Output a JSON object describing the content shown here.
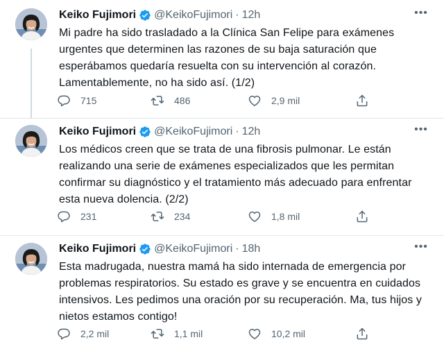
{
  "tweets": [
    {
      "name": "Keiko Fujimori",
      "handle": "@KeikoFujimori",
      "separator": "·",
      "time": "12h",
      "text": "Mi padre ha sido trasladado a la Clínica San Felipe para exámenes urgentes que determinen las razones de su baja saturación que esperábamos quedaría resuelta con su intervención al corazón. Lamentablemente, no ha sido así. (1/2)",
      "replies": "715",
      "retweets": "486",
      "likes": "2,9 mil"
    },
    {
      "name": "Keiko Fujimori",
      "handle": "@KeikoFujimori",
      "separator": "·",
      "time": "12h",
      "text": "Los médicos creen que se trata de una fibrosis pulmonar. Le están realizando una serie de exámenes especializados que les permitan confirmar su diagnóstico y el tratamiento más adecuado para enfrentar esta nueva dolencia. (2/2)",
      "replies": "231",
      "retweets": "234",
      "likes": "1,8 mil"
    },
    {
      "name": "Keiko Fujimori",
      "handle": "@KeikoFujimori",
      "separator": "·",
      "time": "18h",
      "text": "Esta madrugada, nuestra mamá ha sido internada de emergencia por problemas respiratorios. Su estado es grave y se encuentra en cuidados intensivos. Les pedimos una oración por su recuperación. Ma, tus hijos y nietos estamos contigo!",
      "replies": "2,2 mil",
      "retweets": "1,1 mil",
      "likes": "10,2 mil"
    }
  ],
  "icons": {
    "verified": "verified-badge-icon",
    "more": "more-options-icon",
    "reply": "reply-icon",
    "retweet": "retweet-icon",
    "like": "like-icon",
    "share": "share-icon"
  },
  "colors": {
    "verified_blue": "#1d9bf0",
    "secondary_text": "#536471",
    "divider": "#e1e6ea"
  }
}
